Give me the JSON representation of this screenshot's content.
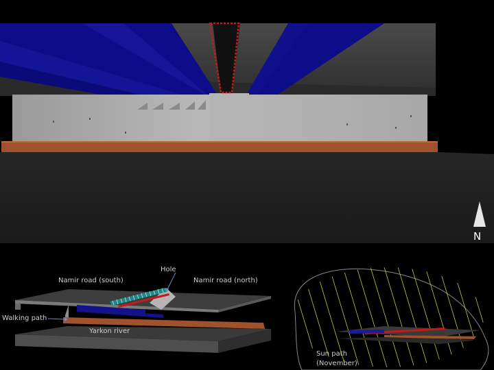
{
  "compass": {
    "north": "N"
  },
  "labels": {
    "hole": "Hole",
    "namir_south": "Namir road (south)",
    "namir_north": "Namir road (north)",
    "walking_path": "Walking path",
    "yarkon_river": "Yarkon river",
    "sun_path_line1": "Sun path",
    "sun_path_line2": "(November)"
  },
  "colors": {
    "background": "#000000",
    "road_grey": "#3a3a3a",
    "blue_beams": "#0d0d8a",
    "hole_outline": "#c41a1a",
    "walking_path": "#a0522d",
    "sun_path_lines": "#c8c832",
    "label_text": "#cfcfcf"
  }
}
